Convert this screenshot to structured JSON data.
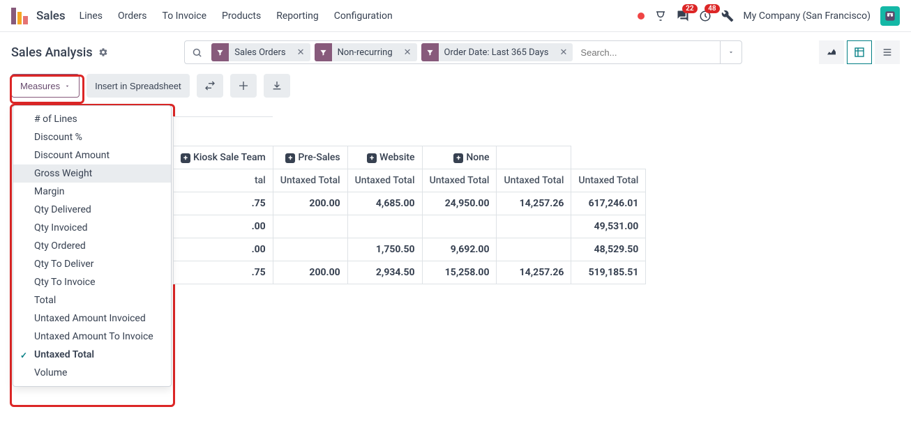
{
  "nav": {
    "brand": "Sales",
    "links": [
      "Lines",
      "Orders",
      "To Invoice",
      "Products",
      "Reporting",
      "Configuration"
    ],
    "messages_badge": "22",
    "activities_badge": "48",
    "company": "My Company (San Francisco)"
  },
  "page": {
    "title": "Sales Analysis"
  },
  "search": {
    "chips": [
      {
        "label": "Sales Orders"
      },
      {
        "label": "Non-recurring"
      },
      {
        "label": "Order Date: Last 365 Days"
      }
    ],
    "placeholder": "Search..."
  },
  "toolbar": {
    "measures": "Measures",
    "insert": "Insert in Spreadsheet"
  },
  "measures_menu": {
    "items": [
      {
        "label": "# of Lines"
      },
      {
        "label": "Discount %"
      },
      {
        "label": "Discount Amount"
      },
      {
        "label": "Gross Weight",
        "hover": true
      },
      {
        "label": "Margin"
      },
      {
        "label": "Qty Delivered"
      },
      {
        "label": "Qty Invoiced"
      },
      {
        "label": "Qty Ordered"
      },
      {
        "label": "Qty To Deliver"
      },
      {
        "label": "Qty To Invoice"
      },
      {
        "label": "Total"
      },
      {
        "label": "Untaxed Amount Invoiced"
      },
      {
        "label": "Untaxed Amount To Invoice"
      },
      {
        "label": "Untaxed Total",
        "selected": true
      },
      {
        "label": "Volume"
      }
    ]
  },
  "pivot": {
    "col_groups": [
      "Kiosk Sale Team",
      "Pre-Sales",
      "Website",
      "None"
    ],
    "sub_header": "Untaxed Total",
    "truncated_header": "tal",
    "rows": [
      {
        "c0": ".75",
        "c1": "200.00",
        "c2": "4,685.00",
        "c3": "24,950.00",
        "c4": "14,257.26",
        "c5": "617,246.01",
        "bold": true
      },
      {
        "c0": ".00",
        "c1": "",
        "c2": "",
        "c3": "",
        "c4": "",
        "c5": "49,531.00",
        "bold": true
      },
      {
        "c0": ".00",
        "c1": "",
        "c2": "1,750.50",
        "c3": "9,692.00",
        "c4": "",
        "c5": "48,529.50",
        "bold": true
      },
      {
        "c0": ".75",
        "c1": "200.00",
        "c2": "2,934.50",
        "c3": "15,258.00",
        "c4": "14,257.26",
        "c5": "519,185.51",
        "bold": true
      }
    ]
  }
}
